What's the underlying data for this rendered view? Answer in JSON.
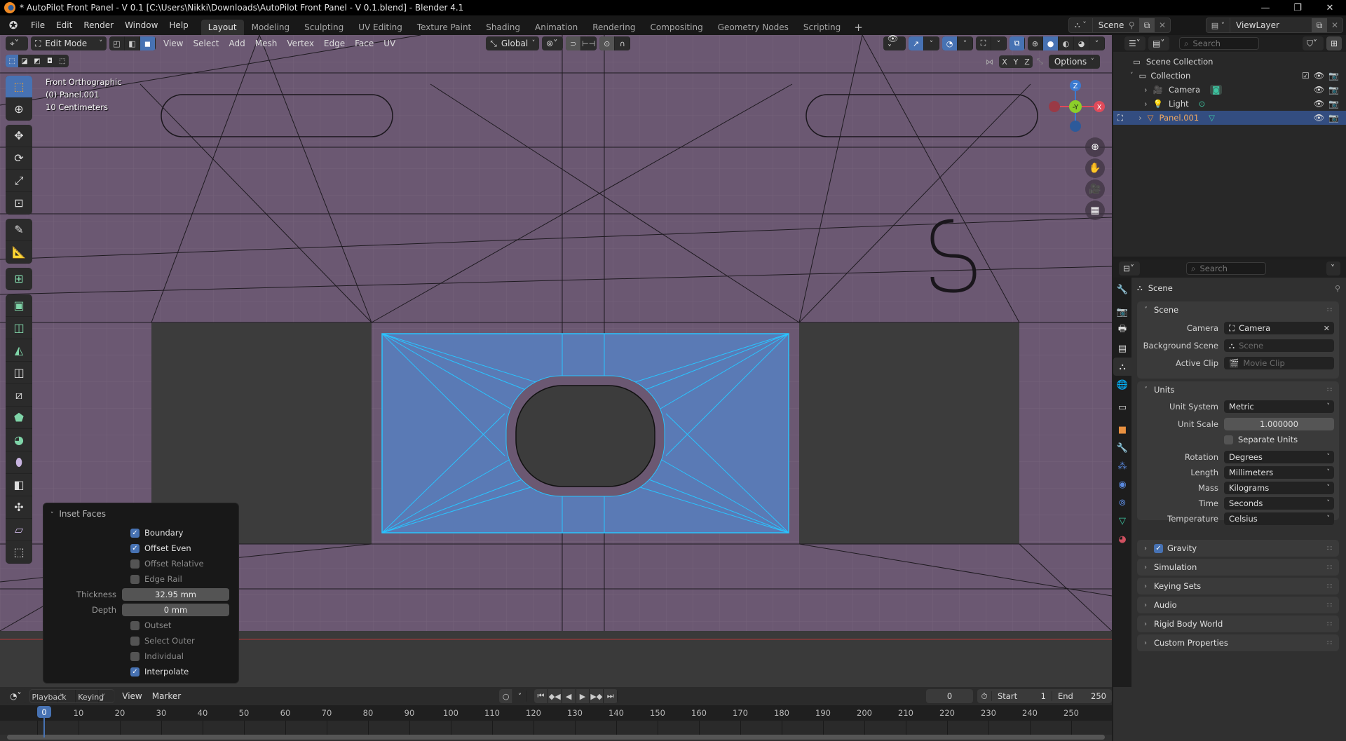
{
  "window": {
    "title": "* AutoPilot Front Panel - V 0.1 [C:\\Users\\Nikki\\Downloads\\AutoPilot Front Panel - V 0.1.blend] - Blender 4.1",
    "controls": {
      "minimize": "—",
      "maximize": "❐",
      "close": "✕"
    }
  },
  "menubar": {
    "items": [
      "File",
      "Edit",
      "Render",
      "Window",
      "Help"
    ]
  },
  "workspaces": {
    "tabs": [
      "Layout",
      "Modeling",
      "Sculpting",
      "UV Editing",
      "Texture Paint",
      "Shading",
      "Animation",
      "Rendering",
      "Compositing",
      "Geometry Nodes",
      "Scripting"
    ],
    "active": "Layout",
    "add_label": "+"
  },
  "scene_selector": {
    "value": "Scene"
  },
  "viewlayer_selector": {
    "value": "ViewLayer"
  },
  "viewport_header": {
    "mode": "Edit Mode",
    "menus": [
      "View",
      "Select",
      "Add",
      "Mesh",
      "Vertex",
      "Edge",
      "Face",
      "UV"
    ],
    "transform_orientation": "Global",
    "options_label": "Options",
    "axis_labels": [
      "X",
      "Y",
      "Z"
    ],
    "select_mode_active": "face"
  },
  "viewport_info": {
    "view": "Front Orthographic",
    "object": "(0) Panel.001",
    "scale": "10 Centimeters"
  },
  "gizmo": {
    "z": "Z",
    "y": "-Y",
    "x": "X"
  },
  "toolbar": {
    "tools": [
      "select-box",
      "cursor",
      "move",
      "rotate",
      "scale",
      "transform",
      "annotate",
      "measure",
      "add-cube",
      "extrude-region",
      "inset-faces",
      "bevel",
      "loop-cut",
      "knife",
      "poly-build",
      "spin",
      "smooth",
      "edge-slide",
      "shrink-fatten",
      "shear",
      "rip-region"
    ],
    "active": "select-box"
  },
  "inset_faces": {
    "title": "Inset Faces",
    "boundary": {
      "label": "Boundary",
      "checked": true
    },
    "offset_even": {
      "label": "Offset Even",
      "checked": true
    },
    "offset_relative": {
      "label": "Offset Relative",
      "checked": false
    },
    "edge_rail": {
      "label": "Edge Rail",
      "checked": false
    },
    "thickness": {
      "label": "Thickness",
      "value": "32.95 mm"
    },
    "depth": {
      "label": "Depth",
      "value": "0 mm"
    },
    "outset": {
      "label": "Outset",
      "checked": false
    },
    "select_outer": {
      "label": "Select Outer",
      "checked": false
    },
    "individual": {
      "label": "Individual",
      "checked": false
    },
    "interpolate": {
      "label": "Interpolate",
      "checked": true
    }
  },
  "outliner": {
    "search_placeholder": "Search",
    "root": "Scene Collection",
    "collection": "Collection",
    "items": [
      {
        "name": "Camera",
        "type": "camera"
      },
      {
        "name": "Light",
        "type": "light"
      },
      {
        "name": "Panel.001",
        "type": "mesh",
        "selected": true
      }
    ]
  },
  "properties": {
    "search_placeholder": "Search",
    "context_title": "Scene",
    "scene_panel": {
      "title": "Scene",
      "camera_label": "Camera",
      "camera_value": "Camera",
      "background_scene_label": "Background Scene",
      "background_scene_placeholder": "Scene",
      "active_clip_label": "Active Clip",
      "active_clip_placeholder": "Movie Clip"
    },
    "units_panel": {
      "title": "Units",
      "unit_system_label": "Unit System",
      "unit_system": "Metric",
      "unit_scale_label": "Unit Scale",
      "unit_scale": "1.000000",
      "separate_units_label": "Separate Units",
      "separate_units": false,
      "rotation_label": "Rotation",
      "rotation": "Degrees",
      "length_label": "Length",
      "length": "Millimeters",
      "mass_label": "Mass",
      "mass": "Kilograms",
      "time_label": "Time",
      "time": "Seconds",
      "temperature_label": "Temperature",
      "temperature": "Celsius"
    },
    "collapsed_panels": [
      {
        "title": "Gravity",
        "checkbox": true
      },
      {
        "title": "Simulation"
      },
      {
        "title": "Keying Sets"
      },
      {
        "title": "Audio"
      },
      {
        "title": "Rigid Body World"
      },
      {
        "title": "Custom Properties"
      }
    ],
    "tabs": [
      "tool",
      "render",
      "output",
      "view-layer",
      "scene",
      "world",
      "collection",
      "object",
      "modifiers",
      "particles",
      "physics",
      "constraints",
      "data",
      "material"
    ],
    "active_tab": "scene"
  },
  "timeline": {
    "menus": [
      "Playback",
      "Keying",
      "View",
      "Marker"
    ],
    "current_frame": "0",
    "start_label": "Start",
    "start": "1",
    "end_label": "End",
    "end": "250",
    "ticks": [
      "0",
      "10",
      "20",
      "30",
      "40",
      "50",
      "60",
      "70",
      "80",
      "90",
      "100",
      "110",
      "120",
      "130",
      "140",
      "150",
      "160",
      "170",
      "180",
      "190",
      "200",
      "210",
      "220",
      "230",
      "240",
      "250"
    ]
  },
  "colors": {
    "accent": "#4772b3",
    "selection": "#29c4ff",
    "mesh_face": "#6a5670",
    "selected_face": "#5a7ab5",
    "gizmo_x": "#e04a5a",
    "gizmo_y": "#8ccf2a",
    "gizmo_z": "#3b7ad0"
  }
}
